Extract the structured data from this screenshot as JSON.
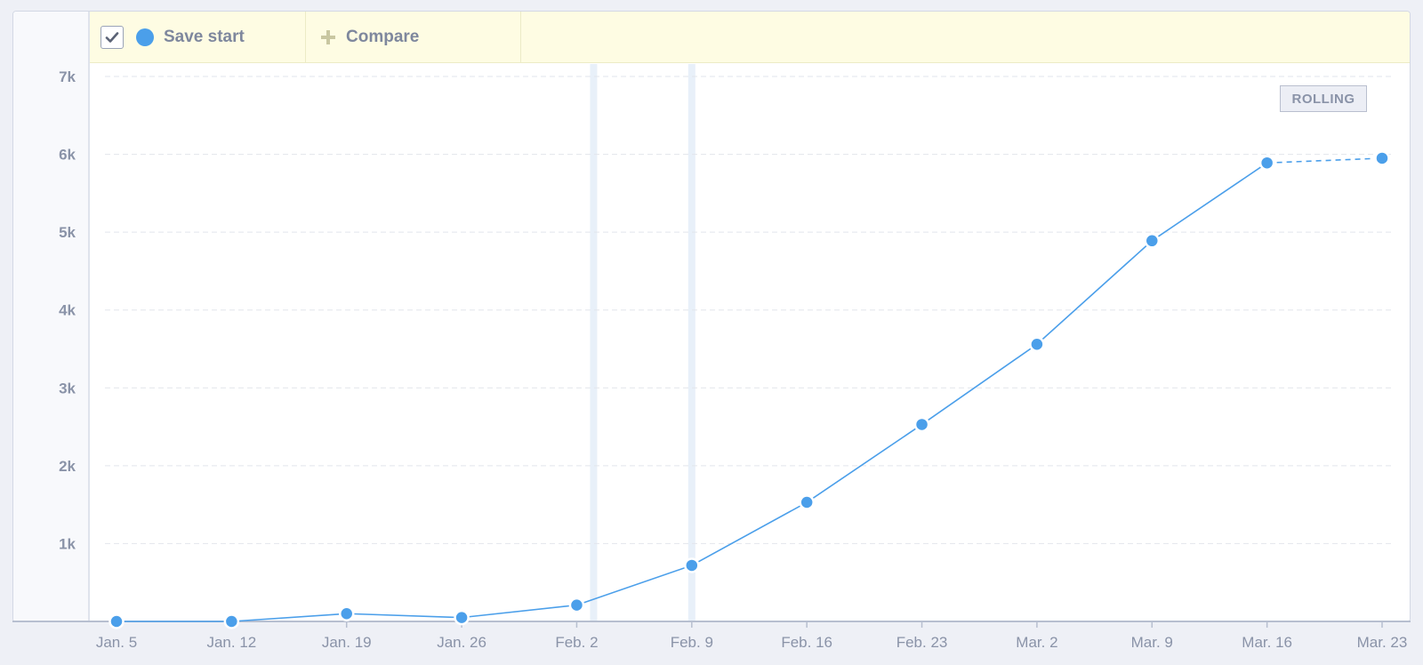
{
  "toolbar": {
    "series_label": "Save start",
    "compare_label": "Compare",
    "series_checked": true
  },
  "badge": {
    "label": "ROLLING"
  },
  "colors": {
    "series": "#4b9fea",
    "marker_band": "#e8f0f9",
    "toolbar_bg": "#fefce3",
    "grid": "#e2e5ec",
    "text": "#8a93a8"
  },
  "chart_data": {
    "type": "line",
    "x": [
      "Jan. 5",
      "Jan. 12",
      "Jan. 19",
      "Jan. 26",
      "Feb. 2",
      "Feb. 9",
      "Feb. 16",
      "Feb. 23",
      "Mar. 2",
      "Mar. 9",
      "Mar. 16",
      "Mar. 23"
    ],
    "series": [
      {
        "values": [
          0,
          0,
          100,
          50,
          210,
          720,
          1530,
          2530,
          3560,
          4890,
          5890,
          5950
        ],
        "dashed_last_segment": true
      }
    ],
    "y_ticks": [
      "1k",
      "2k",
      "3k",
      "4k",
      "5k",
      "6k",
      "7k"
    ],
    "y_tick_values": [
      1000,
      2000,
      3000,
      4000,
      5000,
      6000,
      7000
    ],
    "ylim": [
      0,
      7000
    ],
    "grid": true,
    "marker_bands_after": [
      "Feb. 2",
      "Feb. 9"
    ]
  }
}
